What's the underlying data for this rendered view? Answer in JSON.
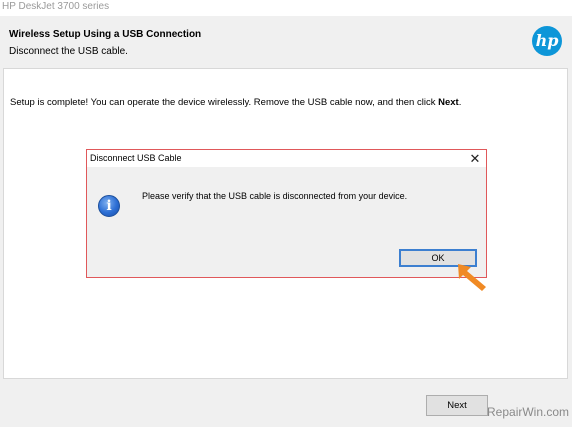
{
  "window": {
    "title": "HP DeskJet 3700 series"
  },
  "header": {
    "title": "Wireless Setup Using a USB Connection",
    "subtitle": "Disconnect the USB cable.",
    "logo_text": "hp",
    "logo_color": "#0d96d8"
  },
  "content": {
    "message_prefix": "Setup is complete! You can operate the device wirelessly. Remove the USB cable now, and then click ",
    "message_emphasis": "Next",
    "message_suffix": "."
  },
  "dialog": {
    "title": "Disconnect USB Cable",
    "close_glyph": "✕",
    "icon": "info-icon",
    "icon_glyph": "i",
    "message": "Please verify that the USB cable is disconnected from your device.",
    "ok_label": "OK",
    "border_color": "#e0585a"
  },
  "footer": {
    "next_label": "Next"
  },
  "watermark": {
    "text": "RepairWin.com"
  },
  "annotation": {
    "arrow_color": "#f08a24"
  }
}
